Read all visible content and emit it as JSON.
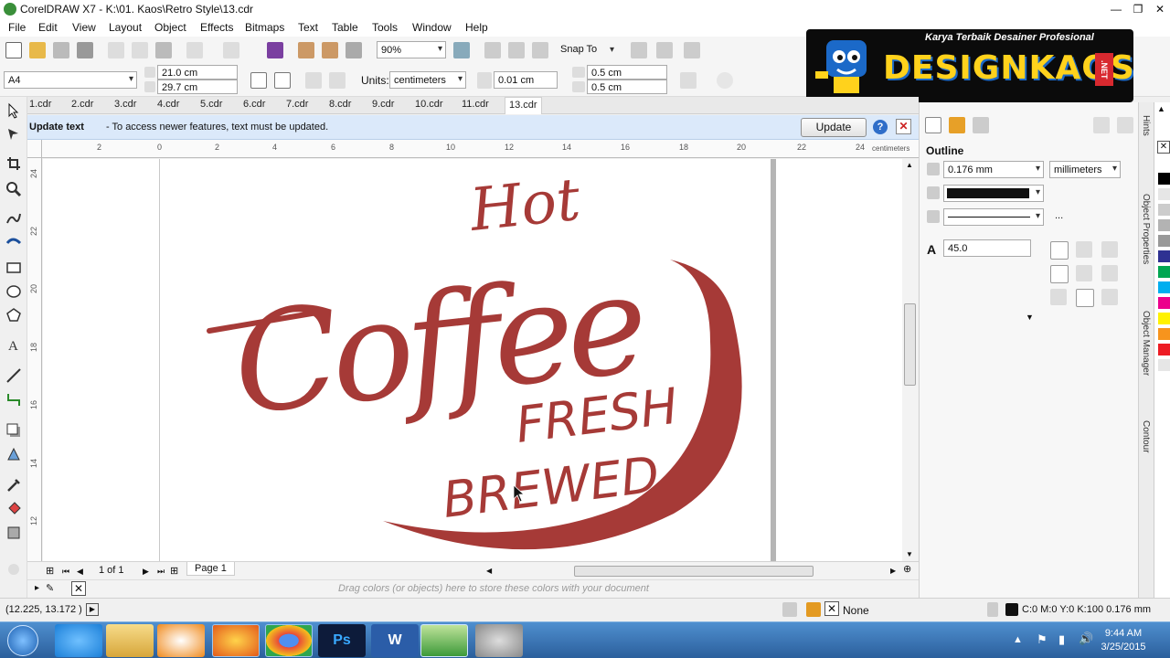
{
  "window": {
    "title": "CorelDRAW X7 - K:\\01. Kaos\\Retro Style\\13.cdr"
  },
  "menu": [
    "File",
    "Edit",
    "View",
    "Layout",
    "Object",
    "Effects",
    "Bitmaps",
    "Text",
    "Table",
    "Tools",
    "Window",
    "Help"
  ],
  "standard_toolbar": {
    "zoom": "90%",
    "snap_to": "Snap To"
  },
  "property_bar": {
    "page_size": "A4",
    "width": "21.0 cm",
    "height": "29.7 cm",
    "units_label": "Units:",
    "units": "centimeters",
    "nudge": "0.01 cm",
    "dup_x": "0.5 cm",
    "dup_y": "0.5 cm"
  },
  "logo": {
    "tagline": "Karya Terbaik Desainer Profesional",
    "brand": "DESIGNKAOS",
    "tld": ".NET"
  },
  "doc_tabs": [
    "1.cdr",
    "2.cdr",
    "3.cdr",
    "4.cdr",
    "5.cdr",
    "6.cdr",
    "7.cdr",
    "8.cdr",
    "9.cdr",
    "10.cdr",
    "11.cdr",
    "13.cdr"
  ],
  "active_tab": "13.cdr",
  "banner": {
    "title": "Update text",
    "message": "-  To access newer features, text must be updated.",
    "button": "Update"
  },
  "ruler": {
    "units": "centimeters",
    "h_ticks": [
      "2",
      "0",
      "2",
      "4",
      "6",
      "8",
      "10",
      "12",
      "14",
      "16",
      "18",
      "20",
      "22",
      "24"
    ],
    "v_ticks": [
      "24",
      "22",
      "20",
      "18",
      "16",
      "14",
      "12"
    ]
  },
  "artwork": {
    "line1": "Hot",
    "line2": "Coffee",
    "line3": "FRESH",
    "line4": "BREWED",
    "color": "#a63a37"
  },
  "page_nav": {
    "count": "1 of 1",
    "page_tab": "Page 1"
  },
  "palette_hint": "Drag colors (or objects) here to store these colors with your document",
  "docker": {
    "section": "Outline",
    "width": "0.176 mm",
    "units": "millimeters",
    "miter": "45.0",
    "style_more": "..."
  },
  "docker_tabs": [
    "Hints",
    "Object Properties",
    "Object Manager",
    "Contour"
  ],
  "palette_colors": [
    "#ffffff",
    "#000000",
    "#e6e6e6",
    "#cccccc",
    "#b3b3b3",
    "#999999",
    "#2e3192",
    "#00a651",
    "#00aeef",
    "#ec008c",
    "#fff200",
    "#f7941d",
    "#ed1c24",
    "#e6e6e6",
    "#ffffff"
  ],
  "status": {
    "coords": "(12.225, 13.172 )",
    "fill": "None",
    "outline": "C:0 M:0 Y:0 K:100  0.176 mm"
  },
  "clock": {
    "time": "9:44 AM",
    "date": "3/25/2015"
  }
}
